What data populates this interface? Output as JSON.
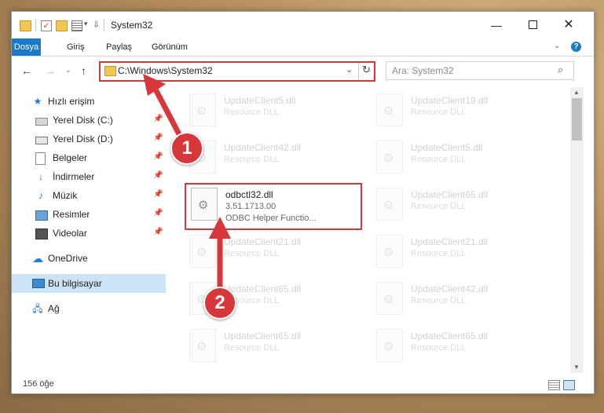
{
  "window": {
    "title": "System32",
    "minimize_glyph": "—",
    "close_glyph": "✕"
  },
  "ribbon": {
    "tabs": [
      "Dosya",
      "Giriş",
      "Paylaş",
      "Görünüm"
    ],
    "help_glyph": "?"
  },
  "nav": {
    "address": "C:\\Windows\\System32",
    "search_placeholder": "Ara: System32"
  },
  "sidebar": {
    "items": [
      {
        "label": "Hızlı erişim",
        "icon": "star-icon"
      },
      {
        "label": "Yerel Disk (C:)",
        "icon": "drive-icon",
        "pinned": true
      },
      {
        "label": "Yerel Disk (D:)",
        "icon": "drive-icon",
        "pinned": true
      },
      {
        "label": "Belgeler",
        "icon": "documents-icon",
        "pinned": true
      },
      {
        "label": "İndirmeler",
        "icon": "download-icon",
        "pinned": true
      },
      {
        "label": "Müzik",
        "icon": "music-icon",
        "pinned": true
      },
      {
        "label": "Resimler",
        "icon": "pictures-icon",
        "pinned": true
      },
      {
        "label": "Videolar",
        "icon": "videos-icon",
        "pinned": true
      },
      {
        "label": "OneDrive",
        "icon": "cloud-icon"
      },
      {
        "label": "Bu bilgisayar",
        "icon": "computer-icon",
        "selected": true
      },
      {
        "label": "Ağ",
        "icon": "network-icon"
      }
    ]
  },
  "files": [
    {
      "name": "UpdateClient5.dll",
      "desc": "Resource DLL"
    },
    {
      "name": "UpdateClient19.dll",
      "desc": "Resource DLL"
    },
    {
      "name": "UpdateClient42.dll",
      "desc": "Resource DLL"
    },
    {
      "name": "UpdateClient5.dll",
      "desc": "Resource DLL"
    },
    {
      "name": "odbctl32.dll",
      "version": "3.51.1713.00",
      "desc": "ODBC Helper Functio...",
      "highlighted": true
    },
    {
      "name": "UpdateClient65.dll",
      "desc": "Resource DLL"
    },
    {
      "name": "UpdateClient21.dll",
      "desc": "Resource DLL"
    },
    {
      "name": "UpdateClient21.dll",
      "desc": "Resource DLL"
    },
    {
      "name": "UpdateClient65.dll",
      "desc": "Resource DLL"
    },
    {
      "name": "UpdateClient42.dll",
      "desc": "Resource DLL"
    },
    {
      "name": "UpdateClient65.dll",
      "desc": "Resource DLL"
    },
    {
      "name": "UpdateClient65.dll",
      "desc": "Resource DLL"
    }
  ],
  "status": {
    "count": "156 öğe"
  },
  "annotations": {
    "step1": "1",
    "step2": "2",
    "color": "#d8373a"
  }
}
